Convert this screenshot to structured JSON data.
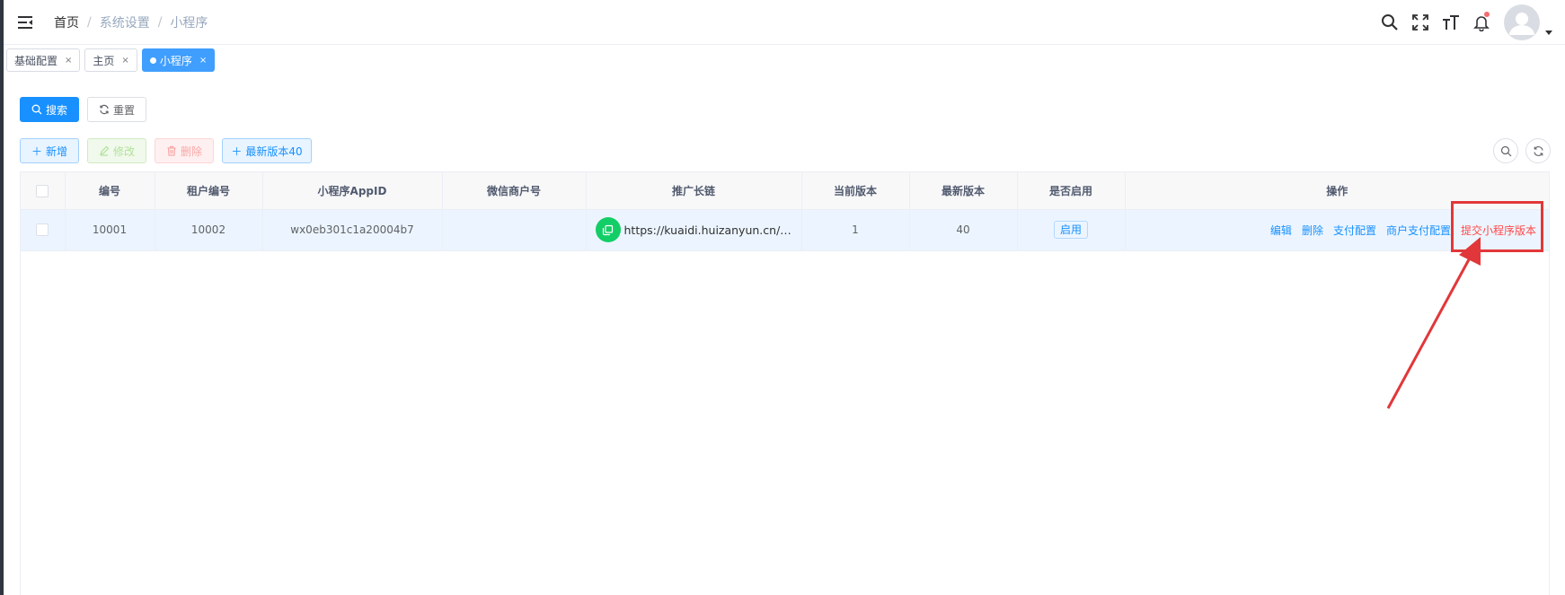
{
  "breadcrumb": [
    "首页",
    "系统设置",
    "小程序"
  ],
  "breadcrumb_separator": "/",
  "header": {
    "icons": [
      "search-icon",
      "fullscreen-icon",
      "font-size-icon",
      "bell-icon",
      "avatar",
      "chevron-down-icon"
    ]
  },
  "tags": [
    {
      "label": "基础配置",
      "active": false,
      "close": "×"
    },
    {
      "label": "主页",
      "active": false,
      "close": "×"
    },
    {
      "label": "小程序",
      "active": true,
      "close": "×"
    }
  ],
  "search_bar": {
    "search_label": "搜索",
    "reset_label": "重置"
  },
  "toolbar": {
    "add_label": "新增",
    "edit_label": "修改",
    "delete_label": "删除",
    "latest_version_label": "最新版本40"
  },
  "table": {
    "columns": [
      "编号",
      "租户编号",
      "小程序AppID",
      "微信商户号",
      "推广长链",
      "当前版本",
      "最新版本",
      "是否启用",
      "操作"
    ],
    "rows": [
      {
        "id": "10001",
        "tenant_id": "10002",
        "appid": "wx0eb301c1a20004b7",
        "merchant_no": "",
        "promo_link": "https://kuaidi.huizanyun.cn/prod...",
        "current_version": "1",
        "latest_version": "40",
        "enabled": "启用",
        "actions": [
          "编辑",
          "删除",
          "支付配置",
          "商户支付配置",
          "提交小程序版本"
        ]
      }
    ]
  },
  "colors": {
    "primary": "#1890ff",
    "active_tag": "#409eff",
    "danger": "#ff4949",
    "annotation": "#e2373a",
    "copy_icon": "#13ce66"
  }
}
